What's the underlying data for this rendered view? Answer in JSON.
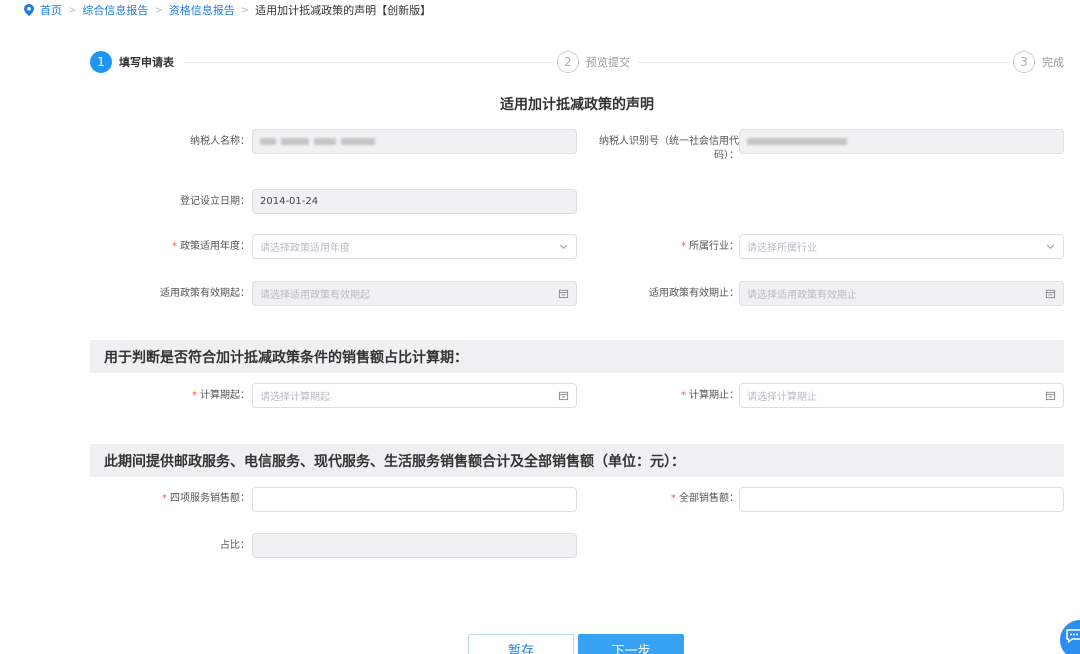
{
  "breadcrumb": {
    "home": "首页",
    "level1": "综合信息报告",
    "level2": "资格信息报告",
    "current": "适用加计抵减政策的声明【创新版】"
  },
  "steps": [
    {
      "number": "1",
      "label": "填写申请表",
      "state": "active"
    },
    {
      "number": "2",
      "label": "预览提交",
      "state": "pending"
    },
    {
      "number": "3",
      "label": "完成",
      "state": "pending"
    }
  ],
  "form": {
    "title": "适用加计抵减政策的声明",
    "taxpayer_name_label": "纳税人名称：",
    "taxpayer_id_label_line1": "纳税人识别号（统一社会信用代",
    "taxpayer_id_label_line2": "码）：",
    "register_date_label": "登记设立日期：",
    "register_date_value": "2014-01-24",
    "policy_year_label": "政策适用年度：",
    "policy_year_placeholder": "请选择政策适用年度",
    "industry_label": "所属行业：",
    "industry_placeholder": "请选择所属行业",
    "effective_start_label": "适用政策有效期起：",
    "effective_start_placeholder": "请选择适用政策有效期起",
    "effective_end_label": "适用政策有效期止：",
    "effective_end_placeholder": "请选择适用政策有效期止",
    "calc_start_label": "计算期起：",
    "calc_start_placeholder": "请选择计算期起",
    "calc_end_label": "计算期止：",
    "calc_end_placeholder": "请选择计算期止",
    "four_services_label": "四项服务销售额：",
    "four_services_value": "",
    "total_sales_label": "全部销售额：",
    "total_sales_value": "",
    "ratio_label": "占比：",
    "ratio_value": "",
    "required_mark": "*"
  },
  "sections": {
    "sales_ratio": "用于判断是否符合加计抵减政策条件的销售额占比计算期：",
    "sales_amount": "此期间提供邮政服务、电信服务、现代服务、生活服务销售额合计及全部销售额（单位：元）："
  },
  "buttons": {
    "save": "暂存",
    "next": "下一步"
  },
  "colors": {
    "accent": "#1f96f2",
    "required": "#e85c4a"
  }
}
